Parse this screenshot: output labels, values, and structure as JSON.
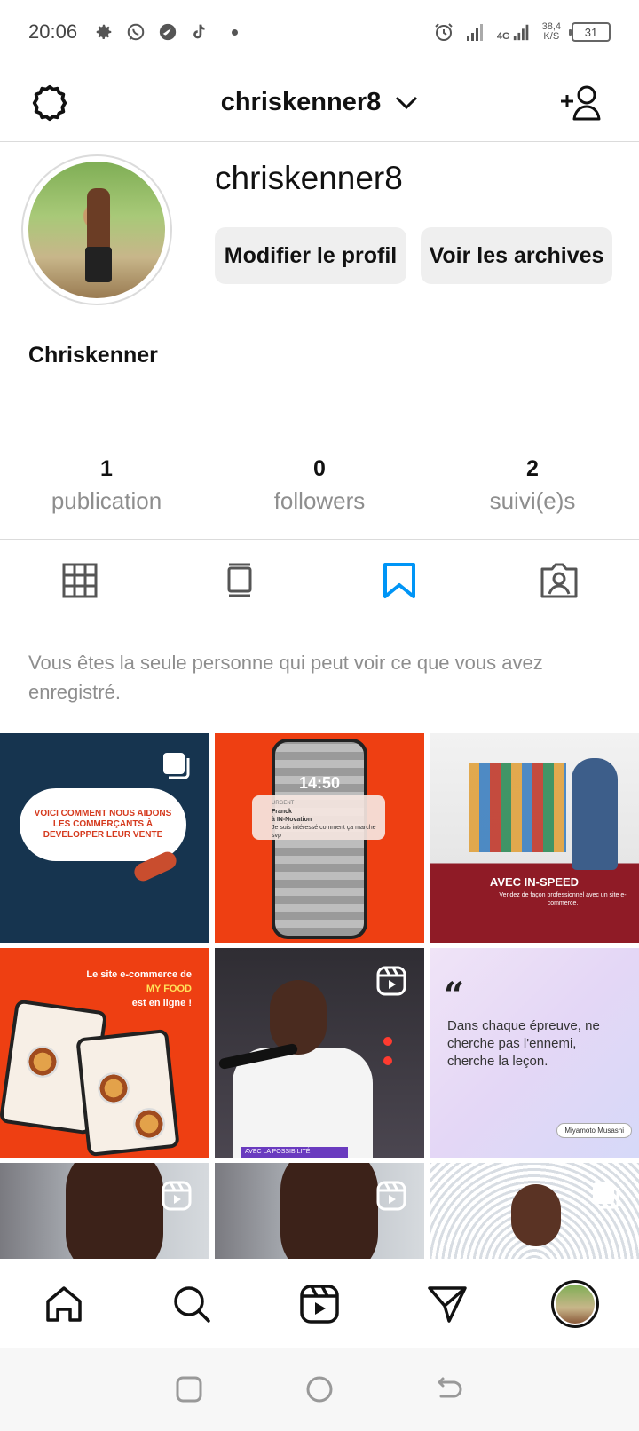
{
  "status_bar": {
    "time": "20:06",
    "icons": [
      "gear-icon",
      "whatsapp-icon",
      "bird-app-icon",
      "tiktok-icon"
    ],
    "network": "4G",
    "speed_value": "38,4",
    "speed_unit": "K/S",
    "battery": "31"
  },
  "header": {
    "username": "chriskenner8",
    "settings_icon": "gear-icon",
    "add_user_icon": "add-user-icon"
  },
  "profile": {
    "display_username": "chriskenner8",
    "edit_button": "Modifier le profil",
    "archive_button": "Voir les archives",
    "full_name": "Chriskenner"
  },
  "stats": [
    {
      "value": "1",
      "label": "publication"
    },
    {
      "value": "0",
      "label": "followers"
    },
    {
      "value": "2",
      "label": "suivi(e)s"
    }
  ],
  "tabs": [
    {
      "icon": "grid-icon",
      "active": false
    },
    {
      "icon": "feed-icon",
      "active": false
    },
    {
      "icon": "bookmark-icon",
      "active": true
    },
    {
      "icon": "tagged-icon",
      "active": false
    }
  ],
  "saved_note": "Vous êtes la seule personne qui peut voir ce que vous avez enregistré.",
  "grid": {
    "tile1": {
      "text": "VOICI COMMENT NOUS AIDONS LES COMMERÇANTS À DEVELOPPER LEUR VENTE"
    },
    "tile2": {
      "notif_title": "URGENT",
      "notif_sender": "Franck",
      "notif_dest": "à IN-Novation",
      "notif_body": "Je suis intéressé comment ça marche svp",
      "clock": "14:50"
    },
    "tile3": {
      "caption": "AVEC IN-SPEED",
      "sub": "Vendez de façon professionnel avec un site e-commerce."
    },
    "tile4": {
      "line1": "Le site e-commerce de",
      "line2": "MY FOOD",
      "line3": "est en ligne !"
    },
    "tile5": {
      "strip": "AVEC LA POSSIBILITÉ"
    },
    "tile6": {
      "quote": "Dans chaque épreuve, ne cherche pas l'ennemi, cherche la leçon.",
      "author": "Miyamoto Musashi"
    }
  },
  "bottom_nav": [
    "home-icon",
    "search-icon",
    "reels-icon",
    "direct-icon",
    "profile-avatar"
  ],
  "colors": {
    "accent": "#0095f6",
    "muted": "#8e8e8e",
    "border": "#dbdbdb",
    "button": "#efefef"
  }
}
